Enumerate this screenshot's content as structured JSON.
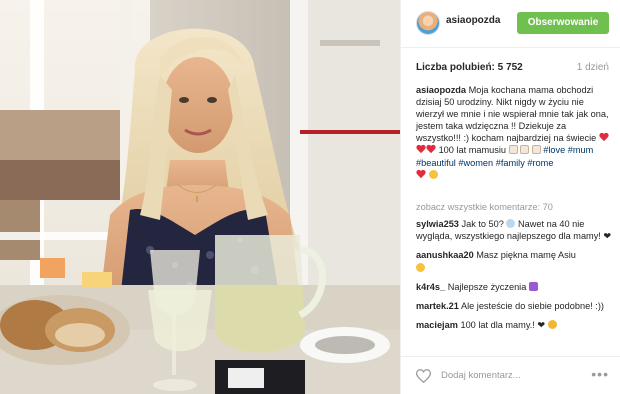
{
  "post": {
    "image_alt": "",
    "header": {
      "username": "asiaopozda",
      "follow_label": "Obserwowanie"
    },
    "stats": {
      "likes_text": "Liczba polubień: 5 752",
      "time_ago": "1 dzień"
    },
    "caption": {
      "username": "asiaopozda",
      "text": "Moja kochana mama obchodzi dzisiaj 50 urodziny. Nikt nigdy w życiu nie wierzył we mnie i nie wspierał mnie tak jak ona, jestem taka wdzięczna !! Dziekuje za wszystko!!! :) kocham najbardziej na świecie",
      "text2": "100 lat mamusiu",
      "hashtags": [
        "#love",
        "#mum",
        "#beautiful",
        "#women",
        "#family",
        "#rome"
      ]
    },
    "view_all": "zobacz wszystkie komentarze: 70",
    "comments": [
      {
        "user": "sylwia253",
        "text": "Jak to 50?",
        "text2": "Nawet na 40 nie wygląda, wszystkiego najlepszego dla mamy! ❤"
      },
      {
        "user": "aanushkaa20",
        "text": "Masz piękna mamę Asiu",
        "text2": ""
      },
      {
        "user": "k4r4s_",
        "text": "Najlepsze życzenia",
        "text2": ""
      },
      {
        "user": "martek.21",
        "text": "Ale jesteście do siebie podobne! :))",
        "text2": ""
      },
      {
        "user": "maciejam",
        "text": "100 lat dla mamy.! ❤",
        "text2": ""
      }
    ],
    "footer": {
      "add_comment_placeholder": "Dodaj komentarz...",
      "more_options": "•••"
    },
    "colors": {
      "follow_green": "#70c050",
      "hashtag_blue": "#003569",
      "muted_gray": "#999999",
      "heart_red": "#e02c3d"
    },
    "icons": [
      "heart-icon",
      "more-options-icon"
    ]
  }
}
